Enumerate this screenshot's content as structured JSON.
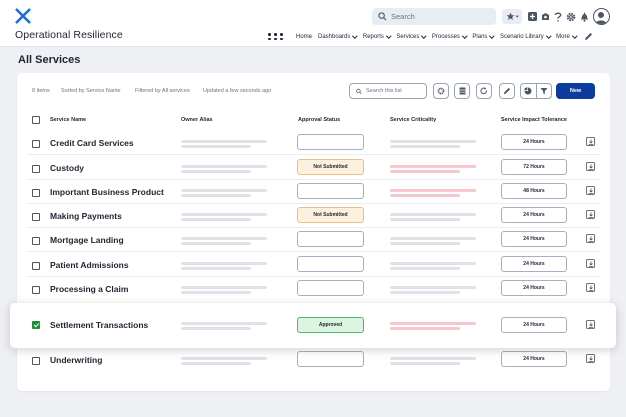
{
  "header": {
    "app_title": "Operational Resilience",
    "search_placeholder": "Search",
    "nav": [
      {
        "label": "Home",
        "dropdown": false
      },
      {
        "label": "Dashboards",
        "dropdown": true
      },
      {
        "label": "Reports",
        "dropdown": true
      },
      {
        "label": "Services",
        "dropdown": true
      },
      {
        "label": "Processes",
        "dropdown": true
      },
      {
        "label": "Plans",
        "dropdown": true
      },
      {
        "label": "Scenario Library",
        "dropdown": true
      },
      {
        "label": "More",
        "dropdown": true
      }
    ]
  },
  "page": {
    "title": "All Services"
  },
  "list": {
    "item_count": "8 items",
    "sort_info": "Sorted by Service Name",
    "filter_info": "Filtered by All services",
    "updated_info": "Updated a few seconds ago",
    "search_placeholder": "Search this list",
    "new_label": "New"
  },
  "columns": {
    "name": "Service Name",
    "alias": "Owner Alias",
    "approval": "Approval Status",
    "criticality": "Service Criticality",
    "tolerance": "Service Impact Tolerance"
  },
  "rows": [
    {
      "name": "Credit Card Services",
      "status": "",
      "status_type": "empty",
      "tolerance": "24 Hours",
      "checked": false
    },
    {
      "name": "Custody",
      "status": "Not Submitted",
      "status_type": "ns",
      "tolerance": "72 Hours",
      "checked": false
    },
    {
      "name": "Important Business Product",
      "status": "",
      "status_type": "empty",
      "tolerance": "48 Hours",
      "checked": false
    },
    {
      "name": "Making Payments",
      "status": "Not Submitted",
      "status_type": "ns",
      "tolerance": "24 Hours",
      "checked": false
    },
    {
      "name": "Mortgage Landing",
      "status": "",
      "status_type": "empty",
      "tolerance": "24 Hours",
      "checked": false
    },
    {
      "name": "Patient Admissions",
      "status": "",
      "status_type": "empty",
      "tolerance": "24 Hours",
      "checked": false
    },
    {
      "name": "Processing a Claim",
      "status": "",
      "status_type": "empty",
      "tolerance": "24 Hours",
      "checked": false
    },
    {
      "name": "Settlement Transactions",
      "status": "Approved",
      "status_type": "ap",
      "tolerance": "24 Hours",
      "checked": true
    },
    {
      "name": "Underwriting",
      "status": "",
      "status_type": "empty",
      "tolerance": "24 Hours",
      "checked": false
    }
  ],
  "colors": {
    "brand": "#0d3b9e",
    "not_submitted_bg": "#fdf0dd",
    "approved_bg": "#dcf5e0",
    "criticality_bar": "#f6c7cc",
    "checkbox_checked": "#1f8f3a"
  }
}
